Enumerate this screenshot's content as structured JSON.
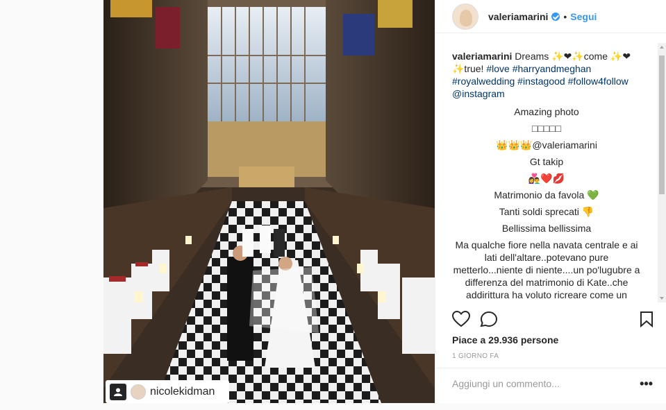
{
  "post": {
    "author": "valeriamarini",
    "follow_label": "Segui",
    "dot": "•",
    "tagged_user": "nicolekidman",
    "image_alt": "Royal wedding procession in chapel"
  },
  "caption": {
    "user": "valeriamarini",
    "text": "Dreams ✨❤✨come ✨❤ ✨true!",
    "hashtags": "#love #harryandmeghan #royalwedding #instagood #follow4follow @instagram"
  },
  "comments": [
    "Amazing photo",
    "□□□□□",
    "👑👑👑@valeriamarini",
    "Gt takip",
    "👩‍❤️‍👨❤️💋",
    "Matrimonio da favola 💚",
    "Tanti soldi sprecati 👎",
    "Bellissima bellissima",
    "Ma qualche fiore nella navata centrale e ai lati dell'altare..potevano pure metterlo...niente di niente....un po'lugubre a differenza del matrimonio di Kate..che addirittura ha voluto ricreare come un"
  ],
  "likes_text": "Piace a 29.936 persone",
  "timestamp": "1 GIORNO FA",
  "comment_placeholder": "Aggiungi un commento...",
  "more_label": "•••",
  "colors": {
    "accent": "#3897f0",
    "hashtag": "#003569",
    "text": "#262626",
    "muted": "#999999"
  },
  "icons": [
    "verified-icon",
    "heart-icon",
    "comment-icon",
    "save-icon",
    "more-icon",
    "user-tag-icon"
  ]
}
